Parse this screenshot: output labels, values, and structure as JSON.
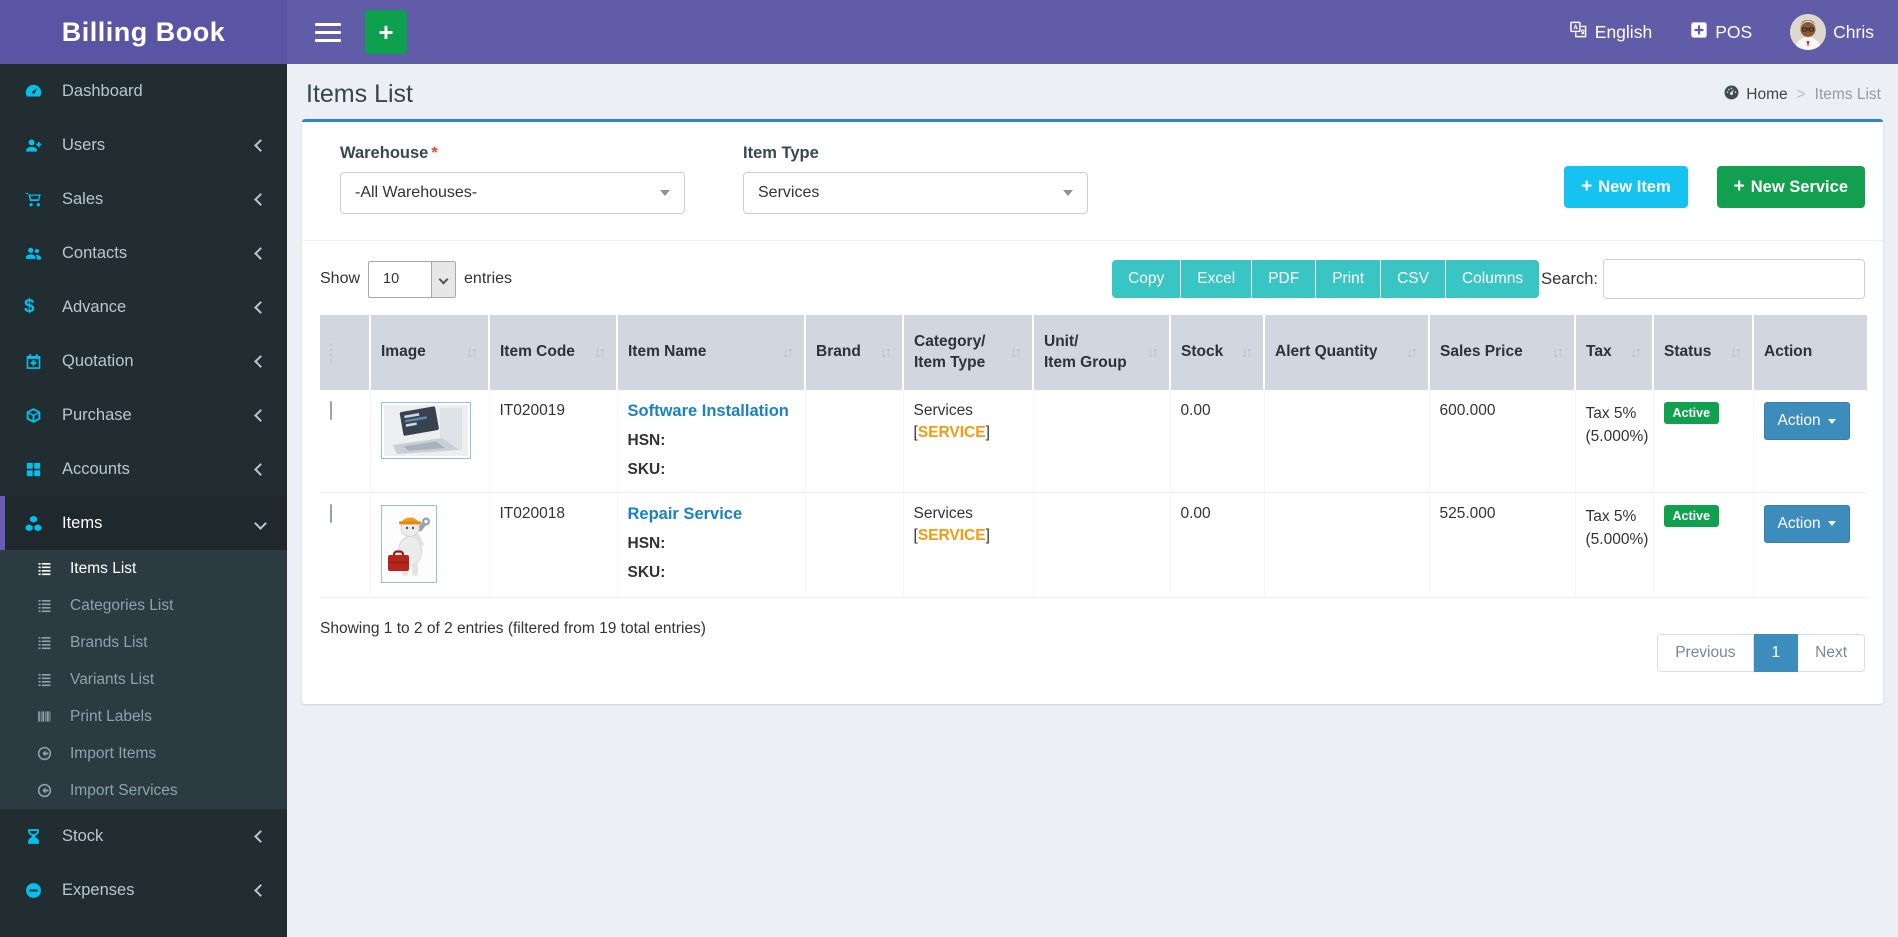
{
  "topbar": {
    "brand": "Billing Book",
    "language": "English",
    "pos": "POS",
    "user": "Chris"
  },
  "page": {
    "title": "Items List",
    "breadcrumb": {
      "home": "Home",
      "sep": ">",
      "current": "Items List"
    }
  },
  "icons": {
    "plus": "+",
    "sort_down": "↓",
    "sort_up": "↑"
  },
  "sidebar": {
    "items": [
      {
        "label": "Dashboard",
        "icon": "dashboard"
      },
      {
        "label": "Users",
        "icon": "user-plus"
      },
      {
        "label": "Sales",
        "icon": "cart"
      },
      {
        "label": "Contacts",
        "icon": "users"
      },
      {
        "label": "Advance",
        "icon": "dollar"
      },
      {
        "label": "Quotation",
        "icon": "calendar-plus"
      },
      {
        "label": "Purchase",
        "icon": "cube"
      },
      {
        "label": "Accounts",
        "icon": "grid"
      },
      {
        "label": "Items",
        "icon": "cubes"
      },
      {
        "label": "Stock",
        "icon": "hourglass"
      },
      {
        "label": "Expenses",
        "icon": "minus-circle"
      }
    ],
    "subitems": [
      {
        "label": "Items List",
        "icon": "list",
        "active": true
      },
      {
        "label": "Categories List",
        "icon": "list"
      },
      {
        "label": "Brands List",
        "icon": "list"
      },
      {
        "label": "Variants List",
        "icon": "list"
      },
      {
        "label": "Print Labels",
        "icon": "barcode"
      },
      {
        "label": "Import Items",
        "icon": "import"
      },
      {
        "label": "Import Services",
        "icon": "import"
      }
    ]
  },
  "filters": {
    "warehouse_label": "Warehouse",
    "required_mark": "*",
    "warehouse_value": "-All Warehouses-",
    "item_type_label": "Item Type",
    "item_type_value": "Services",
    "new_item": "New Item",
    "new_service": "New Service"
  },
  "controls": {
    "show_label": "Show",
    "entries_value": "10",
    "entries_label": "entries",
    "export_buttons": [
      "Copy",
      "Excel",
      "PDF",
      "Print",
      "CSV",
      "Columns"
    ],
    "search_label": "Search:",
    "search_value": ""
  },
  "table": {
    "columns": [
      {
        "label": "Image"
      },
      {
        "label": "Item Code"
      },
      {
        "label": "Item Name"
      },
      {
        "label": "Brand"
      },
      {
        "label": "Category/\nItem Type"
      },
      {
        "label": "Unit/\nItem Group"
      },
      {
        "label": "Stock"
      },
      {
        "label": "Alert Quantity"
      },
      {
        "label": "Sales Price"
      },
      {
        "label": "Tax"
      },
      {
        "label": "Status"
      },
      {
        "label": "Action"
      }
    ],
    "labels": {
      "hsn": "HSN:",
      "sku": "SKU:",
      "bracket_open": "[",
      "bracket_close": "]"
    },
    "rows": [
      {
        "item_code": "IT020019",
        "item_name": "Software Installation",
        "image": "laptop-photo",
        "category_group": "Services",
        "category_tag": "SERVICE",
        "stock": "0.00",
        "sales_price": "600.000",
        "tax": "Tax 5%\n(5.000%)",
        "status_label": "Active",
        "action_label": "Action"
      },
      {
        "item_code": "IT020018",
        "item_name": "Repair Service",
        "image": "repair-mascot",
        "category_group": "Services",
        "category_tag": "SERVICE",
        "stock": "0.00",
        "sales_price": "525.000",
        "tax": "Tax 5%\n(5.000%)",
        "status_label": "Active",
        "action_label": "Action"
      }
    ],
    "info": "Showing 1 to 2 of 2 entries (filtered from 19 total entries)",
    "pagination": {
      "previous": "Previous",
      "page": "1",
      "next": "Next"
    }
  },
  "colors": {
    "accent_purple": "#605ca8",
    "cyan": "#00c0ef",
    "teal": "#3ac5c5",
    "primary_blue": "#3c8dbc",
    "green": "#0fa14e",
    "orange": "#f39c12",
    "new_item_blue": "#14c3ef",
    "new_service_green": "#12a050"
  }
}
